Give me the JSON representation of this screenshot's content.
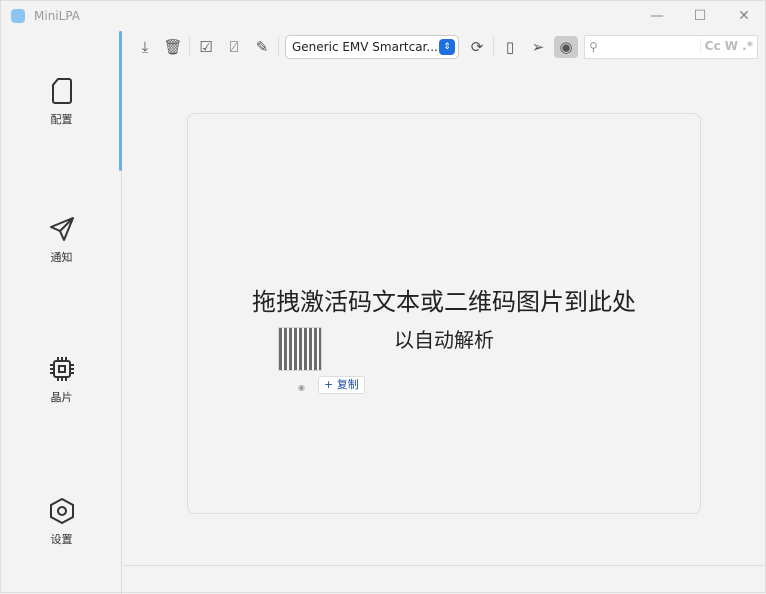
{
  "window": {
    "title": "MiniLPA",
    "minimize": "—",
    "maximize": "☐",
    "close": "✕"
  },
  "sidebar": {
    "items": [
      {
        "label": "配置",
        "icon": "sim-card-icon"
      },
      {
        "label": "通知",
        "icon": "send-icon"
      },
      {
        "label": "晶片",
        "icon": "chip-icon"
      },
      {
        "label": "设置",
        "icon": "settings-hexagon-icon"
      }
    ]
  },
  "toolbar": {
    "reader": "Generic EMV Smartcar...",
    "search_placeholder": "",
    "search_options": "Cc W .*"
  },
  "main": {
    "drop_line1": "拖拽激活码文本或二维码图片到此处",
    "drop_line2": "以自动解析",
    "copy_label": "+ 复制"
  },
  "colors": {
    "accent": "#1e6fe0",
    "indicator": "#6ab0f0"
  }
}
